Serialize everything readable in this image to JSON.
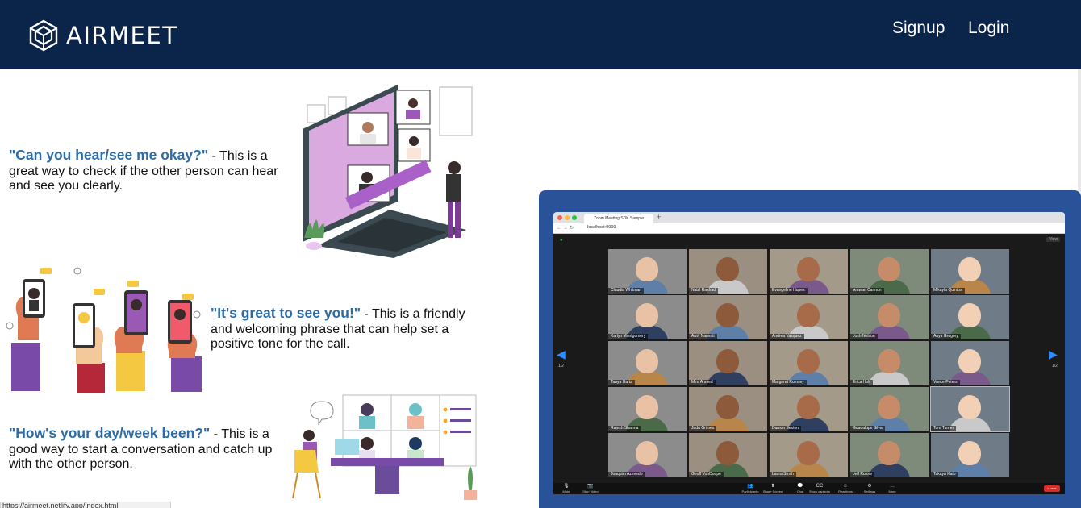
{
  "header": {
    "brand": "AIRMEET",
    "nav": {
      "signup": "Signup",
      "login": "Login"
    },
    "background": "#0a244a"
  },
  "tips": [
    {
      "quote": "\"Can you hear/see me okay?\"",
      "text": " - This is a great way to check if the other person can hear and see you clearly."
    },
    {
      "quote": "\"It's great to see you!\"",
      "text": " - This is a friendly and welcoming phrase that can help set a positive tone for the call."
    },
    {
      "quote": "\"How's your day/week been?\"",
      "text": " - This is a good way to start a conversation and catch up with the other person."
    }
  ],
  "accent_color": "#2b6ca8",
  "statusbar": {
    "url": "https://airmeet.netlify.app/index.html"
  },
  "zoom": {
    "tab_title": "Zoom Meeting SDK Sample",
    "address": "localhost:9999",
    "page_left": "1/2",
    "page_right": "1/2",
    "view_label": "View",
    "participants": [
      "Claudia Whitman",
      "Nabil Rashad",
      "Evangeline Hupes",
      "Antwan Cannon",
      "Mikayla Quintos",
      "Karlyn Montgomery",
      "Amir Nanvati",
      "Andrea Vasquez",
      "Josh Nelson",
      "Anya Gregory",
      "Tanya Hartz",
      "Mira Ahmed",
      "Margaret Rumsey",
      "Erica Holt",
      "Vance Peters",
      "Rajesh Sharma",
      "Jada Grimes",
      "Damon Sexton",
      "Guadalupe Silva",
      "Tom Turner",
      "Joaquim Azevedo",
      "Geoff VonDoupe",
      "Laura Smith",
      "Jeff Ruiore",
      "Takaya Kato"
    ],
    "toolbar": [
      {
        "icon": "🎙",
        "label": "Mute"
      },
      {
        "icon": "📷",
        "label": "Stop Video"
      },
      {
        "icon": "👥",
        "label": "Participants"
      },
      {
        "icon": "⬆",
        "label": "Share Screen"
      },
      {
        "icon": "💬",
        "label": "Chat"
      },
      {
        "icon": "CC",
        "label": "Show captions"
      },
      {
        "icon": "☺",
        "label": "Reactions"
      },
      {
        "icon": "⚙",
        "label": "Settings"
      },
      {
        "icon": "…",
        "label": "More"
      }
    ],
    "leave": "Leave"
  }
}
